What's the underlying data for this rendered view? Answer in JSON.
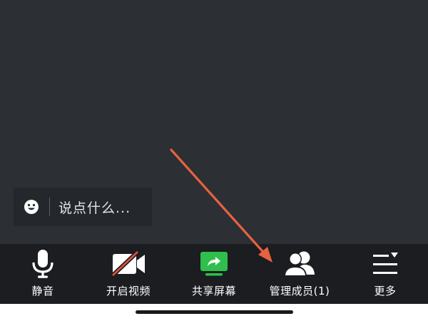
{
  "chat": {
    "placeholder": "说点什么..."
  },
  "toolbar": {
    "items": [
      {
        "label": "静音",
        "icon": "microphone-icon"
      },
      {
        "label": "开启视频",
        "icon": "video-off-icon"
      },
      {
        "label": "共享屏幕",
        "icon": "share-screen-icon"
      },
      {
        "label": "管理成员(1)",
        "icon": "participants-icon"
      },
      {
        "label": "更多",
        "icon": "more-menu-icon"
      }
    ]
  },
  "colors": {
    "meeting_background": "#2c2f34",
    "toolbar_background": "#1b1d20",
    "share_green": "#2fbf4d",
    "video_off_red": "#e0503c",
    "annotation_arrow": "#e8623f"
  }
}
